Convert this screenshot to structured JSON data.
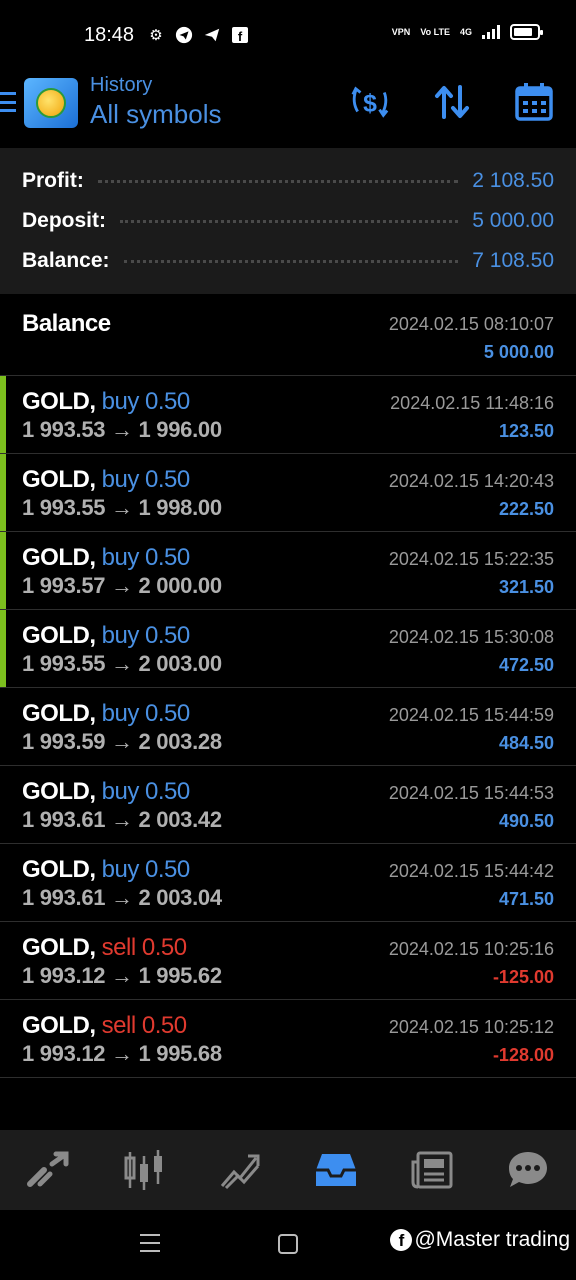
{
  "status_bar": {
    "time": "18:48",
    "left_icons": [
      "gear-icon",
      "telegram-icon",
      "send-icon",
      "facebook-icon"
    ],
    "vpn_label": "VPN",
    "volte_label": "Vo LTE",
    "network_label": "4G",
    "battery_level": 0.8
  },
  "header": {
    "subtitle": "History",
    "title": "All symbols",
    "actions": [
      "dollar-swap-icon",
      "sort-icon",
      "calendar-icon"
    ]
  },
  "summary": {
    "profit_label": "Profit:",
    "profit_value": "2 108.50",
    "deposit_label": "Deposit:",
    "deposit_value": "5 000.00",
    "balance_label": "Balance:",
    "balance_value": "7 108.50"
  },
  "balance_entry": {
    "label": "Balance",
    "time": "2024.02.15 08:10:07",
    "amount": "5 000.00"
  },
  "trades": [
    {
      "symbol": "GOLD,",
      "side": "buy 0.50",
      "type": "buy",
      "prices": "1 993.53 → 1 996.00",
      "time": "2024.02.15 11:48:16",
      "profit": "123.50",
      "marked": true
    },
    {
      "symbol": "GOLD,",
      "side": "buy 0.50",
      "type": "buy",
      "prices": "1 993.55 → 1 998.00",
      "time": "2024.02.15 14:20:43",
      "profit": "222.50",
      "marked": true
    },
    {
      "symbol": "GOLD,",
      "side": "buy 0.50",
      "type": "buy",
      "prices": "1 993.57 → 2 000.00",
      "time": "2024.02.15 15:22:35",
      "profit": "321.50",
      "marked": true
    },
    {
      "symbol": "GOLD,",
      "side": "buy 0.50",
      "type": "buy",
      "prices": "1 993.55 → 2 003.00",
      "time": "2024.02.15 15:30:08",
      "profit": "472.50",
      "marked": true
    },
    {
      "symbol": "GOLD,",
      "side": "buy 0.50",
      "type": "buy",
      "prices": "1 993.59 → 2 003.28",
      "time": "2024.02.15 15:44:59",
      "profit": "484.50",
      "marked": false
    },
    {
      "symbol": "GOLD,",
      "side": "buy 0.50",
      "type": "buy",
      "prices": "1 993.61 → 2 003.42",
      "time": "2024.02.15 15:44:53",
      "profit": "490.50",
      "marked": false
    },
    {
      "symbol": "GOLD,",
      "side": "buy 0.50",
      "type": "buy",
      "prices": "1 993.61 → 2 003.04",
      "time": "2024.02.15 15:44:42",
      "profit": "471.50",
      "marked": false
    },
    {
      "symbol": "GOLD,",
      "side": "sell 0.50",
      "type": "sell",
      "prices": "1 993.12 → 1 995.62",
      "time": "2024.02.15 10:25:16",
      "profit": "-125.00",
      "marked": false
    },
    {
      "symbol": "GOLD,",
      "side": "sell 0.50",
      "type": "sell",
      "prices": "1 993.12 → 1 995.68",
      "time": "2024.02.15 10:25:12",
      "profit": "-128.00",
      "marked": false
    }
  ],
  "bottom_nav": {
    "items": [
      "quotes-icon",
      "chart-icon",
      "trade-icon",
      "history-icon",
      "news-icon",
      "chat-icon"
    ],
    "active": "history-icon"
  },
  "colors": {
    "accent_blue": "#4a90e2",
    "sell_red": "#e03a2f",
    "marker_green": "#7cbf1e"
  },
  "watermark": {
    "text": "@Master trading",
    "badge": "f"
  }
}
